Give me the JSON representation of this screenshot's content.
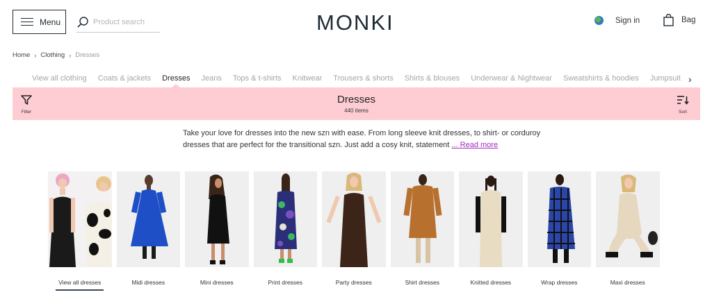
{
  "header": {
    "menu_label": "Menu",
    "search_placeholder": "Product search",
    "logo_text": "MONKI",
    "sign_in_label": "Sign in",
    "bag_label": "Bag"
  },
  "breadcrumb": {
    "home": "Home",
    "clothing": "Clothing",
    "current": "Dresses"
  },
  "category_nav": {
    "items": [
      {
        "label": "View all clothing"
      },
      {
        "label": "Coats & jackets"
      },
      {
        "label": "Dresses"
      },
      {
        "label": "Jeans"
      },
      {
        "label": "Tops & t-shirts"
      },
      {
        "label": "Knitwear"
      },
      {
        "label": "Trousers & shorts"
      },
      {
        "label": "Shirts & blouses"
      },
      {
        "label": "Underwear & Nightwear"
      },
      {
        "label": "Sweatshirts & hoodies"
      },
      {
        "label": "Jumpsuit"
      }
    ],
    "active_index": 2
  },
  "banner": {
    "title": "Dresses",
    "count": "440 items",
    "filter_label": "Filter",
    "sort_label": "Sort",
    "color": "#fecdd3"
  },
  "description": {
    "text": "Take your love for dresses into the new szn with ease. From long sleeve knit dresses, to shirt- or corduroy dresses that are perfect for the transitional szn. Just add a cosy knit, statement ",
    "read_more": "... Read more",
    "link_color": "#a32dbd"
  },
  "tiles": [
    {
      "label": "View all dresses",
      "icon": "dress-photo"
    },
    {
      "label": "Midi dresses",
      "icon": "dress-photo"
    },
    {
      "label": "Mini dresses",
      "icon": "dress-photo"
    },
    {
      "label": "Print dresses",
      "icon": "dress-photo"
    },
    {
      "label": "Party dresses",
      "icon": "dress-photo"
    },
    {
      "label": "Shirt dresses",
      "icon": "dress-photo"
    },
    {
      "label": "Knitted dresses",
      "icon": "dress-photo"
    },
    {
      "label": "Wrap dresses",
      "icon": "dress-photo"
    },
    {
      "label": "Maxi dresses",
      "icon": "dress-photo"
    }
  ],
  "active_tile_index": 0
}
